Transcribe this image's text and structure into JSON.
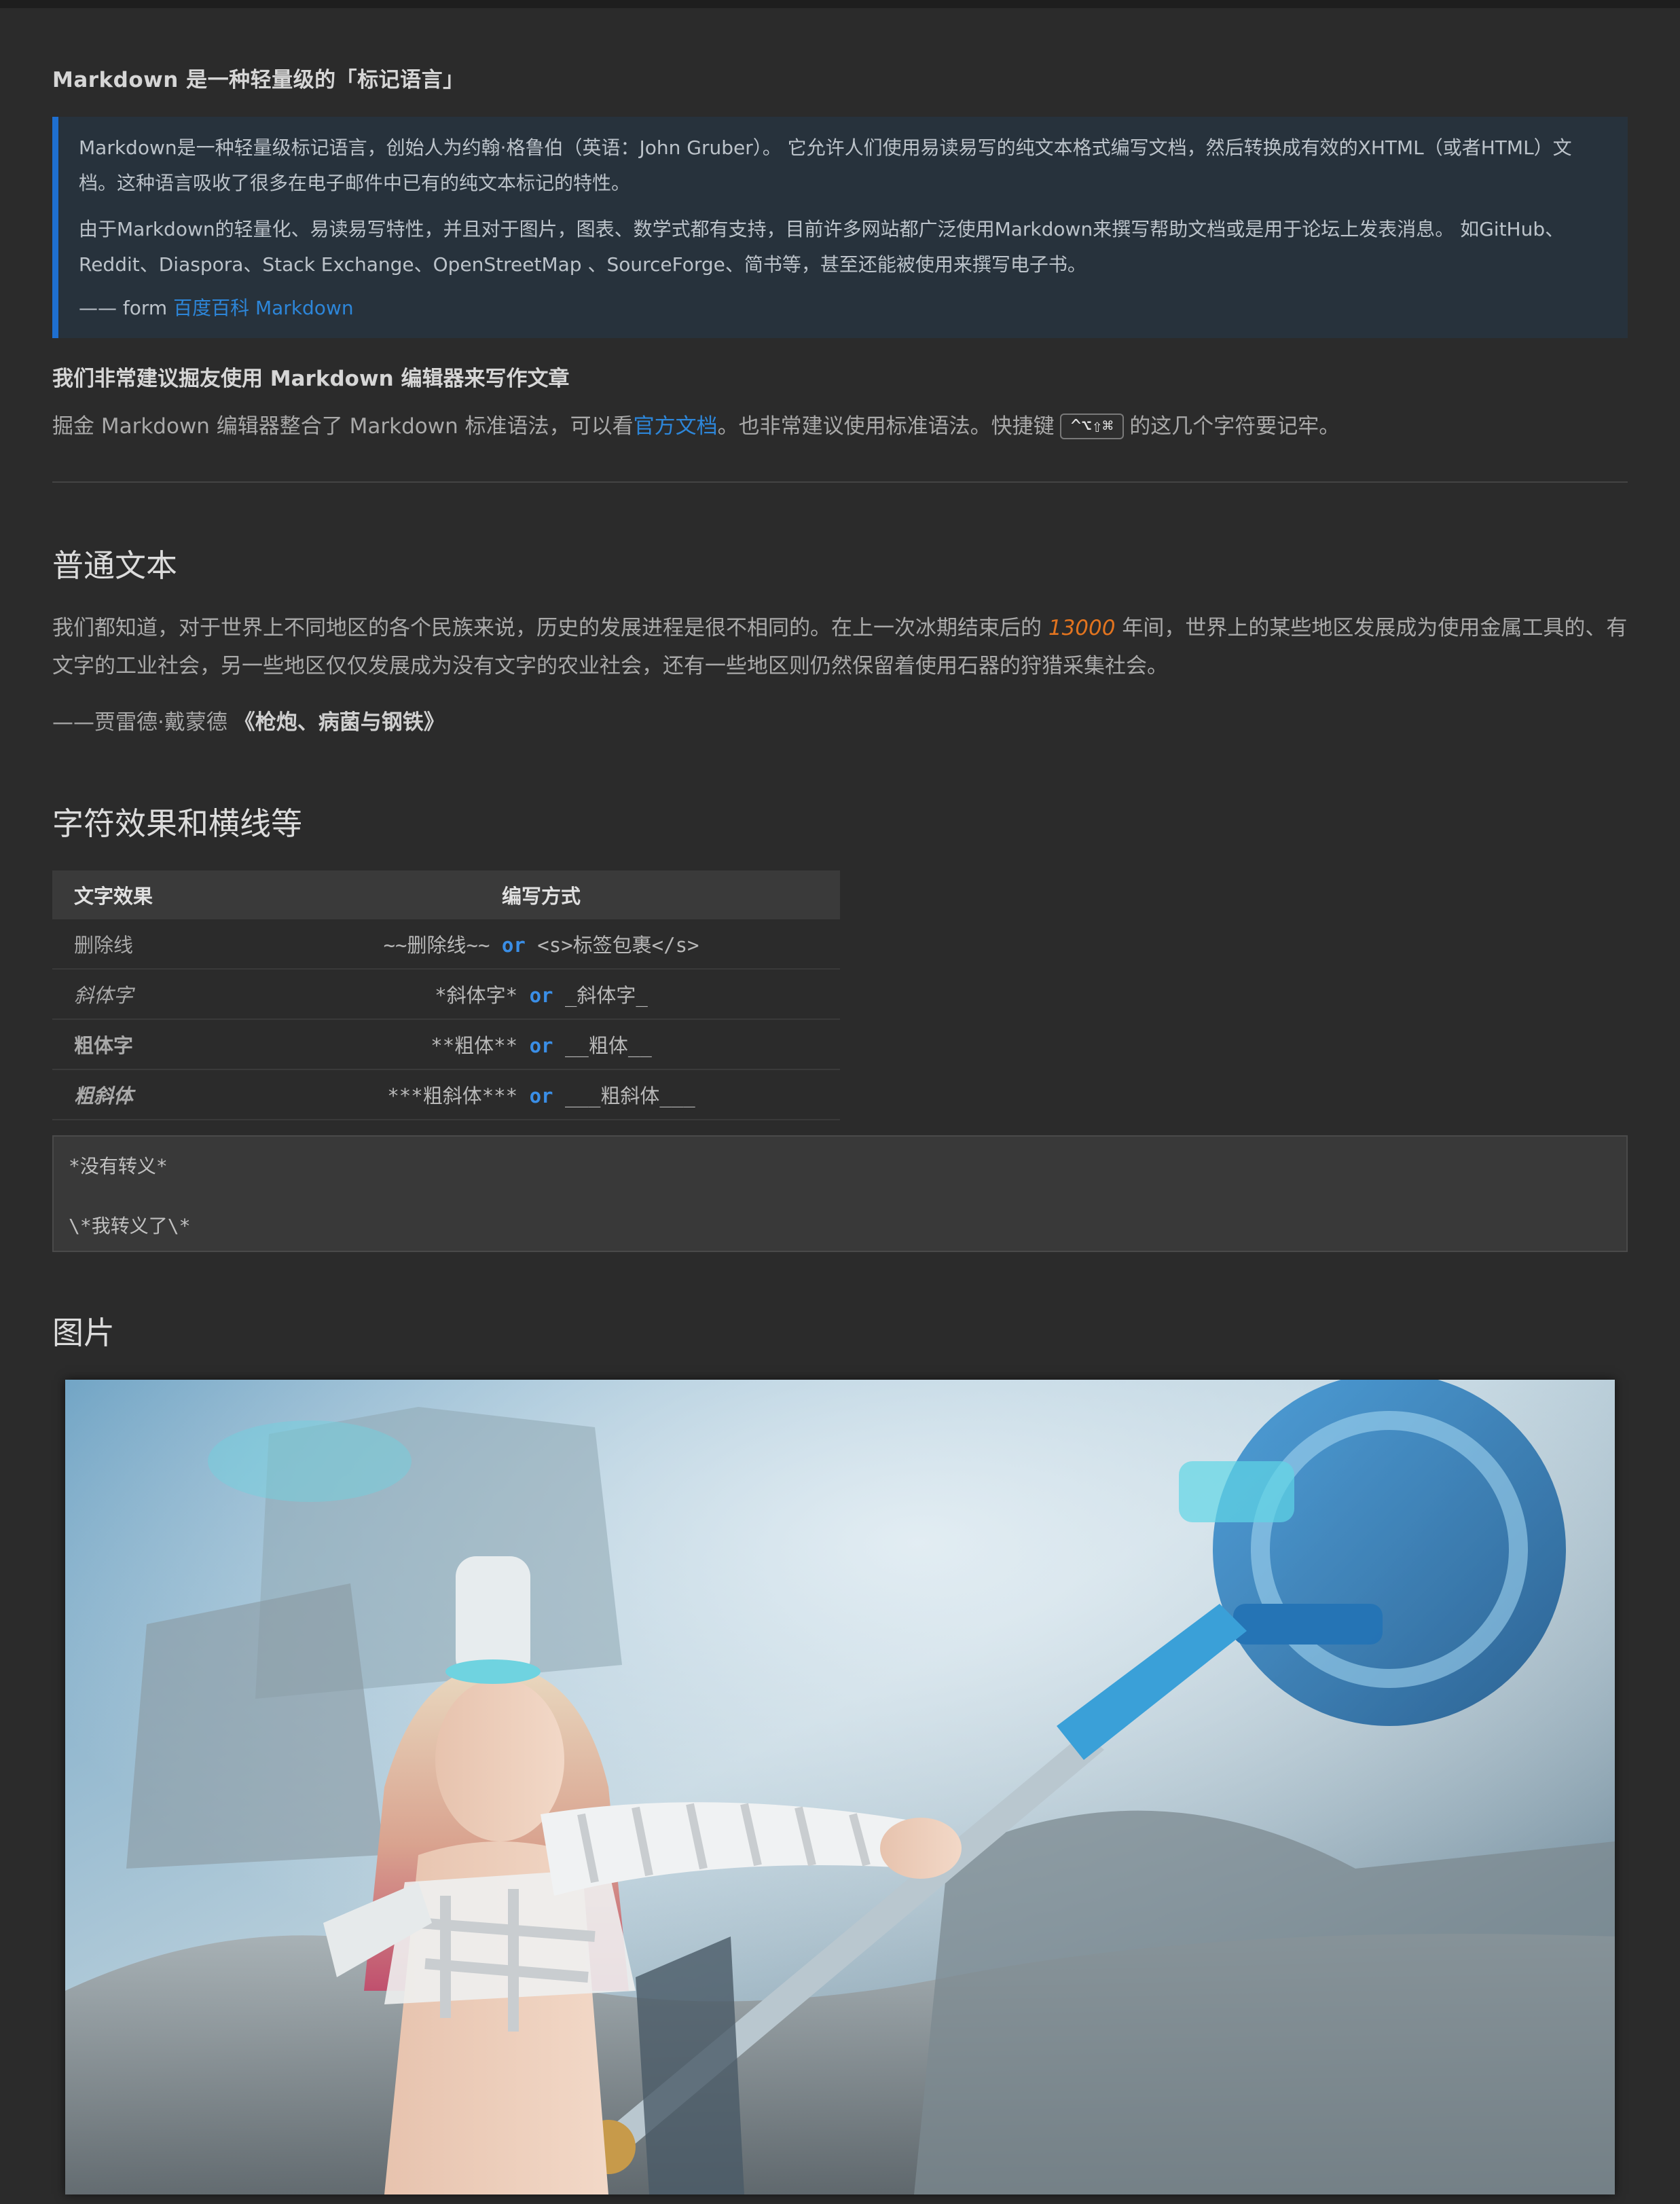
{
  "doc_title": "Markdown 是一种轻量级的「标记语言」",
  "blockquote": {
    "para1": "Markdown是一种轻量级标记语言，创始人为约翰·格鲁伯（英语：John Gruber）。 它允许人们使用易读易写的纯文本格式编写文档，然后转换成有效的XHTML（或者HTML）文档。这种语言吸收了很多在电子邮件中已有的纯文本标记的特性。",
    "para2": "由于Markdown的轻量化、易读易写特性，并且对于图片，图表、数学式都有支持，目前许多网站都广泛使用Markdown来撰写帮助文档或是用于论坛上发表消息。 如GitHub、Reddit、Diaspora、Stack Exchange、OpenStreetMap 、SourceForge、简书等，甚至还能被使用来撰写电子书。",
    "source_prefix": "—— form ",
    "source_link": "百度百科 Markdown"
  },
  "recommend": {
    "heading": "我们非常建议掘友使用 Markdown 编辑器来写作文章",
    "text_before_link": "掘金 Markdown 编辑器整合了 Markdown 标准语法，可以看",
    "link": "官方文档",
    "text_after_link": "。也非常建议使用标准语法。快捷键",
    "shortcut": "^⌥⇧⌘",
    "text_end": "的这几个字符要记牢。"
  },
  "plain_section": {
    "heading": "普通文本",
    "text_before_num": "我们都知道，对于世界上不同地区的各个民族来说，历史的发展进程是很不相同的。在上一次冰期结束后的",
    "number": "13000",
    "text_after_num": "年间，世界上的某些地区发展成为使用金属工具的、有文字的工业社会，另一些地区仅仅发展成为没有文字的农业社会，还有一些地区则仍然保留着使用石器的狩猎采集社会。",
    "attribution_prefix": "——贾雷德·戴蒙德",
    "attribution_book": "《枪炮、病菌与钢铁》"
  },
  "effects_section": {
    "heading": "字符效果和横线等",
    "table": {
      "headers": [
        "文字效果",
        "编写方式"
      ],
      "rows": [
        {
          "effect": "删除线",
          "syntax_a": "~~删除线~~",
          "or": "or",
          "syntax_b": "<s>标签包裹</s>"
        },
        {
          "effect": "斜体字",
          "syntax_a": "*斜体字*",
          "or": "or",
          "syntax_b": "_斜体字_"
        },
        {
          "effect": "粗体字",
          "syntax_a": "**粗体**",
          "or": "or",
          "syntax_b": "__粗体__"
        },
        {
          "effect": "粗斜体",
          "syntax_a": "***粗斜体***",
          "or": "or",
          "syntax_b": "___粗斜体___"
        }
      ]
    },
    "code": {
      "line1": "*没有转义*",
      "line2": "\\*我转义了\\*"
    }
  },
  "image_section": {
    "heading": "图片"
  },
  "colors": {
    "background": "#2b2b2b",
    "blockquote_bg": "#27323c",
    "accent_blue": "#1e6fd0",
    "link": "#2d86d9",
    "orange": "#e2741f"
  }
}
